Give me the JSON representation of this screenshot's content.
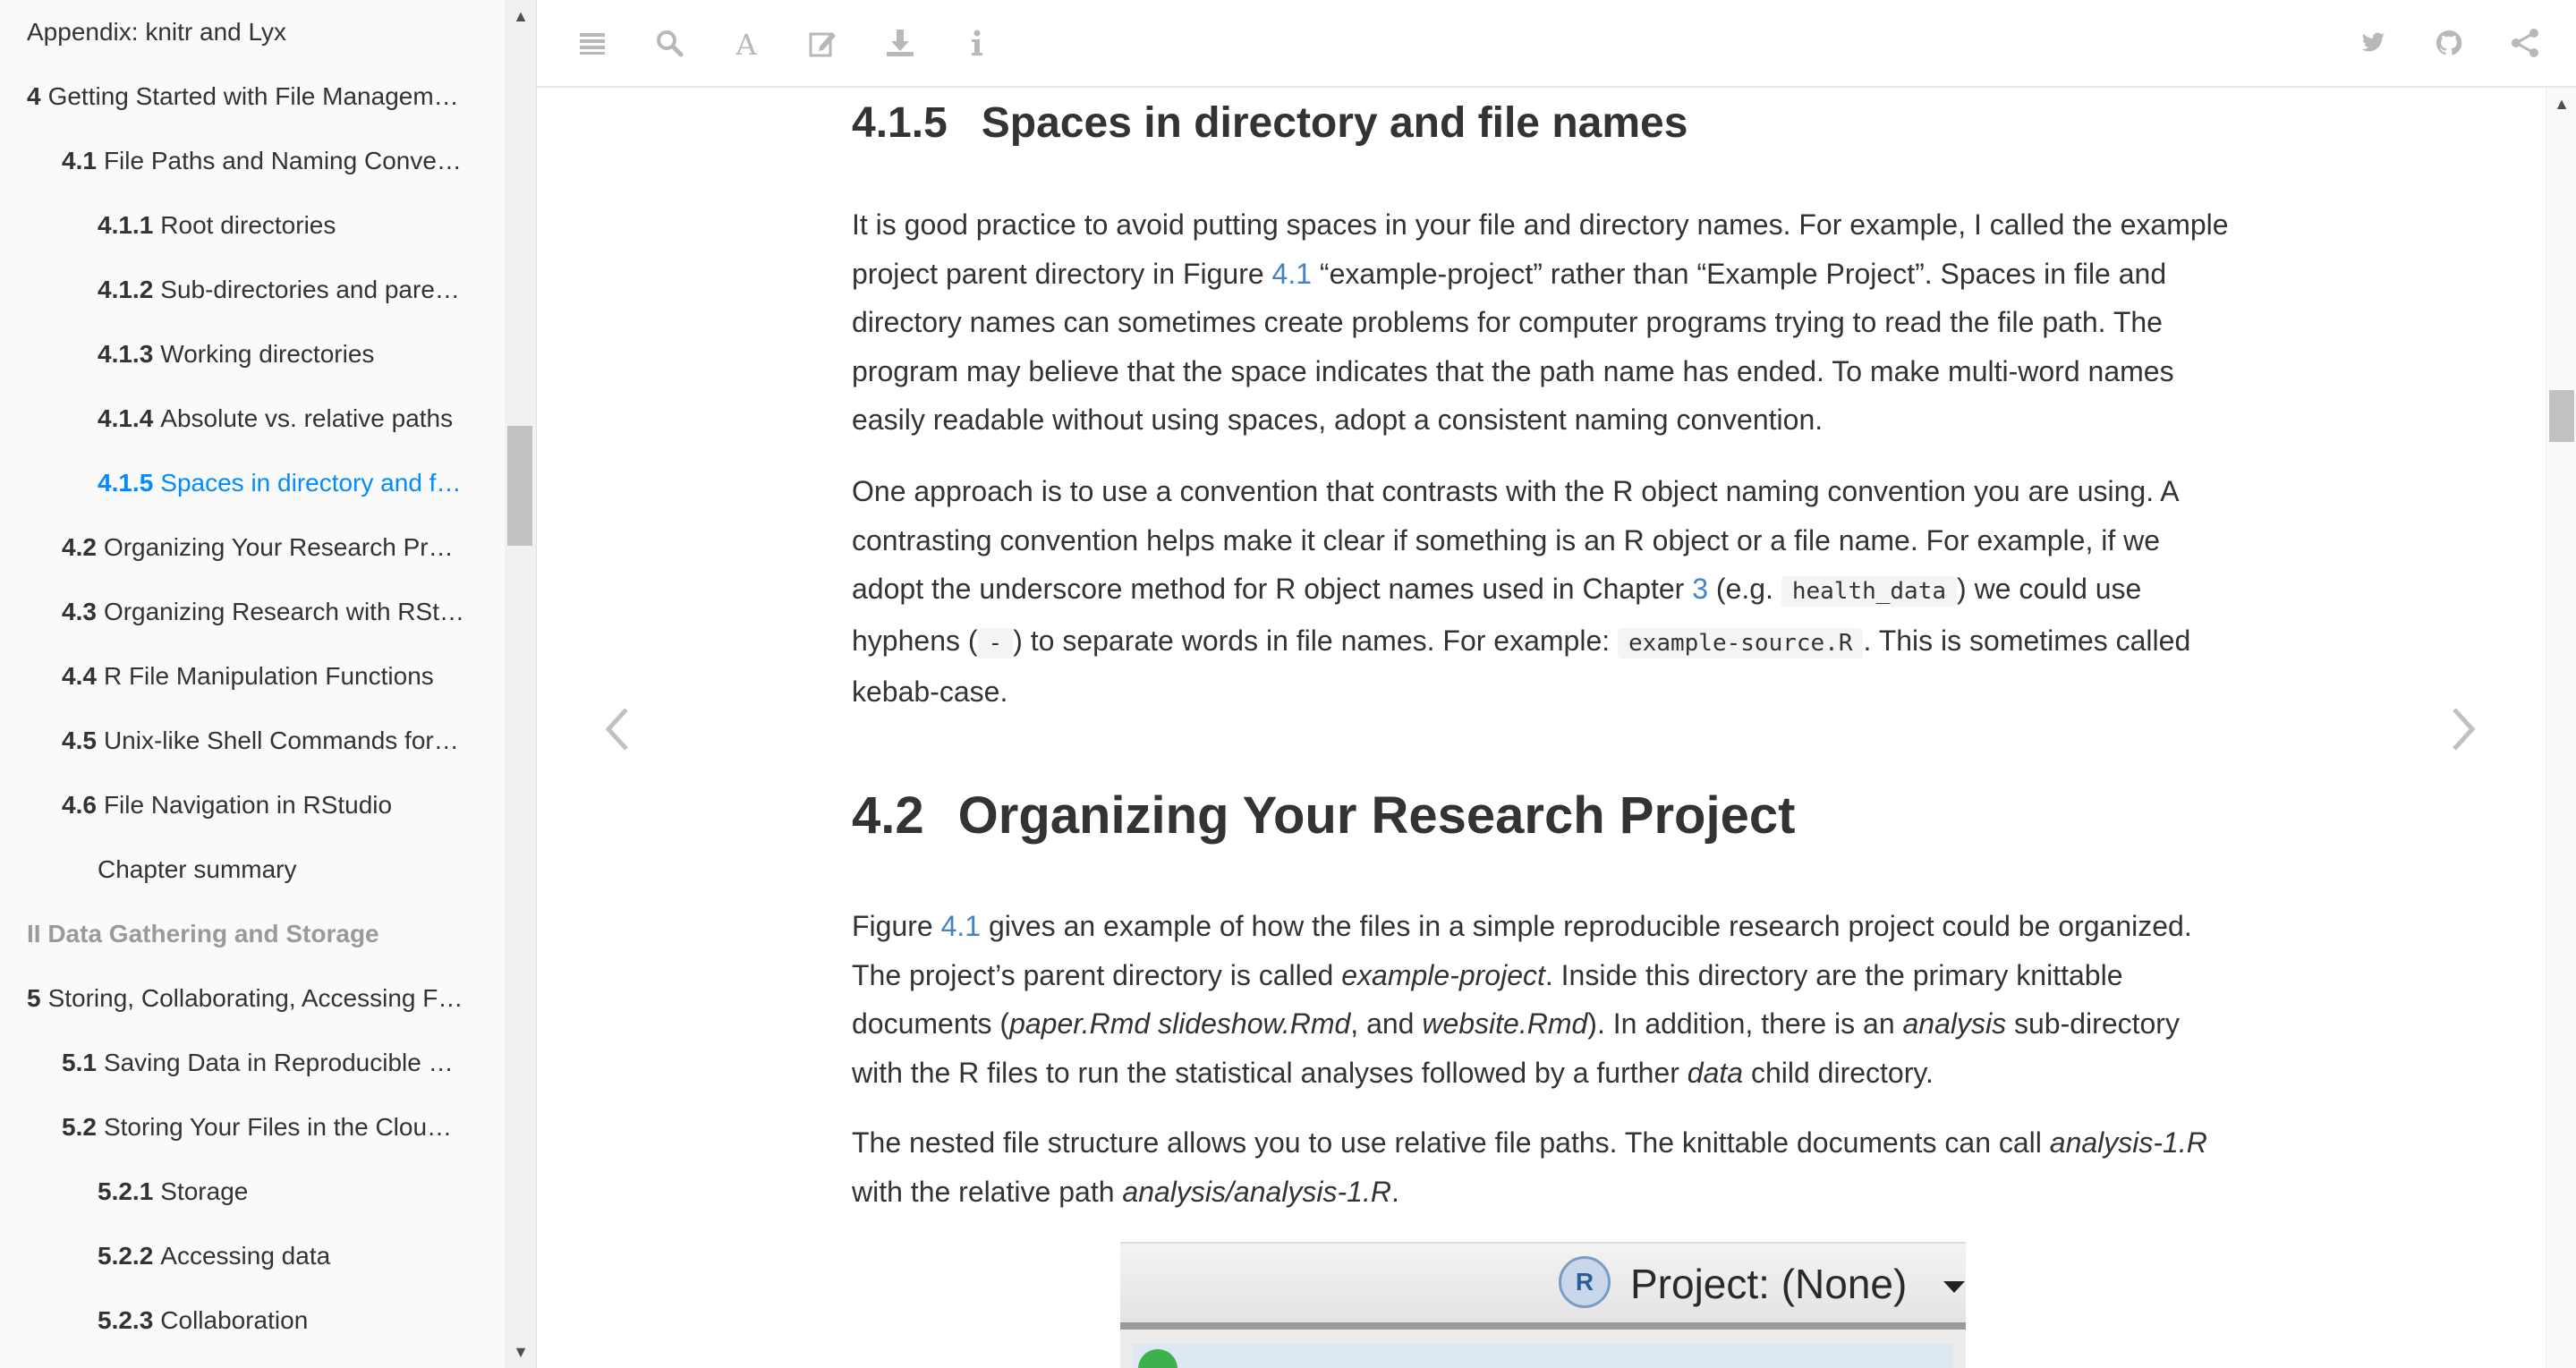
{
  "sidebar": {
    "items": [
      {
        "num": "",
        "label": "Appendix: knitr and Lyx",
        "level": 0,
        "type": "chapter"
      },
      {
        "num": "4",
        "label": "Getting Started with File Managem…",
        "level": 0,
        "type": "chapter"
      },
      {
        "num": "4.1",
        "label": "File Paths and Naming Conve…",
        "level": 1,
        "type": "section"
      },
      {
        "num": "4.1.1",
        "label": "Root directories",
        "level": 2,
        "type": "subsection"
      },
      {
        "num": "4.1.2",
        "label": "Sub-directories and pare…",
        "level": 2,
        "type": "subsection"
      },
      {
        "num": "4.1.3",
        "label": "Working directories",
        "level": 2,
        "type": "subsection"
      },
      {
        "num": "4.1.4",
        "label": "Absolute vs. relative paths",
        "level": 2,
        "type": "subsection"
      },
      {
        "num": "4.1.5",
        "label": "Spaces in directory and f…",
        "level": 2,
        "type": "subsection",
        "active": true
      },
      {
        "num": "4.2",
        "label": "Organizing Your Research Pr…",
        "level": 1,
        "type": "section"
      },
      {
        "num": "4.3",
        "label": "Organizing Research with RSt…",
        "level": 1,
        "type": "section"
      },
      {
        "num": "4.4",
        "label": "R File Manipulation Functions",
        "level": 1,
        "type": "section"
      },
      {
        "num": "4.5",
        "label": "Unix-like Shell Commands for…",
        "level": 1,
        "type": "section"
      },
      {
        "num": "4.6",
        "label": "File Navigation in RStudio",
        "level": 1,
        "type": "section"
      },
      {
        "num": "",
        "label": "Chapter summary",
        "level": 2,
        "type": "subsection"
      },
      {
        "num": "",
        "label": "II Data Gathering and Storage",
        "level": 0,
        "type": "part"
      },
      {
        "num": "5",
        "label": "Storing, Collaborating, Accessing F…",
        "level": 0,
        "type": "chapter"
      },
      {
        "num": "5.1",
        "label": "Saving Data in Reproducible …",
        "level": 1,
        "type": "section"
      },
      {
        "num": "5.2",
        "label": "Storing Your Files in the Clou…",
        "level": 1,
        "type": "section"
      },
      {
        "num": "5.2.1",
        "label": "Storage",
        "level": 2,
        "type": "subsection"
      },
      {
        "num": "5.2.2",
        "label": "Accessing data",
        "level": 2,
        "type": "subsection"
      },
      {
        "num": "5.2.3",
        "label": "Collaboration",
        "level": 2,
        "type": "subsection"
      }
    ],
    "active_color": "#008cff",
    "part_color": "#9a9a9a"
  },
  "toolbar": {
    "left_icons": [
      "menu-icon",
      "search-icon",
      "font-icon",
      "edit-icon",
      "download-icon",
      "info-icon"
    ],
    "right_icons": [
      "twitter-icon",
      "github-icon",
      "share-icon"
    ]
  },
  "content": {
    "sec415": {
      "num": "4.1.5",
      "title": "Spaces in directory and file names",
      "p1": {
        "t1": "It is good practice to avoid putting spaces in your file and directory names. For example, I called the example project parent directory in Figure ",
        "link": "4.1",
        "t2": " “example-project” rather than “Example Project”. Spaces in file and directory names can sometimes create problems for computer programs trying to read the file path. The program may believe that the space indicates that the path name has ended. To make multi-word names easily readable without using spaces, adopt a consistent naming convention."
      },
      "p2": {
        "t1": "One approach is to use a convention that contrasts with the R object naming convention you are using. A contrasting convention helps make it clear if something is an R object or a file name. For example, if we adopt the underscore method for R object names used in Chapter ",
        "link": "3",
        "t2": " (e.g. ",
        "code1": "health_data",
        "t3": ") we could use hyphens (",
        "code2": "-",
        "t4": ") to separate words in file names. For example: ",
        "code3": "example-source.R",
        "t5": ". This is sometimes called kebab-case."
      }
    },
    "sec42": {
      "num": "4.2",
      "title": "Organizing Your Research Project",
      "p1": {
        "t1": "Figure ",
        "link": "4.1",
        "t2": " gives an example of how the files in a simple reproducible research project could be organized. The project’s parent directory is called ",
        "em1": "example-project",
        "t3": ". Inside this directory are the primary knittable documents (",
        "em2": "paper.Rmd slideshow.Rmd",
        "t4": ", and ",
        "em3": "website.Rmd",
        "t5": "). In addition, there is an ",
        "em4": "analysis",
        "t6": " sub-directory with the R files to run the statistical analyses followed by a further ",
        "em5": "data",
        "t7": " child directory."
      },
      "p2": {
        "t1": "The nested file structure allows you to use relative file paths. The knittable documents can call ",
        "em1": "analysis-1.R",
        "t2": " with the relative path ",
        "em2": "analysis/analysis-1.R",
        "t3": "."
      }
    },
    "figure": {
      "project_label": "Project: (None)",
      "r_logo": "R"
    }
  },
  "colors": {
    "link": "#4183c4",
    "text": "#333333",
    "sidebar_bg": "#fafafa"
  }
}
